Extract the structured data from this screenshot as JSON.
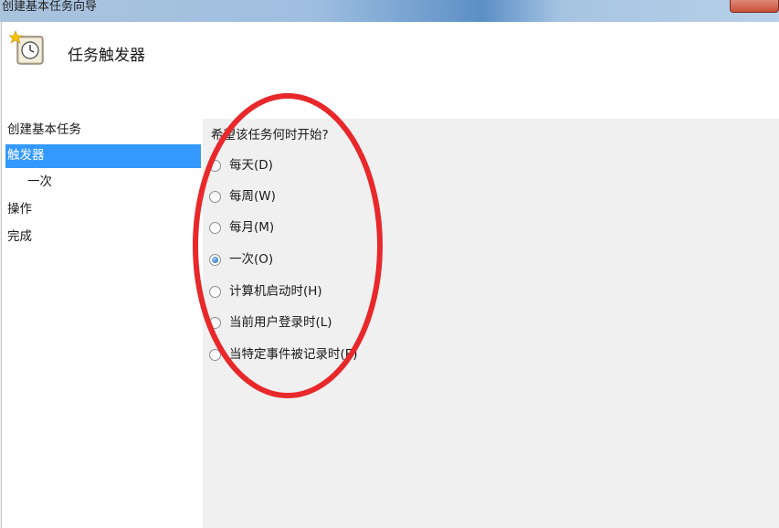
{
  "window": {
    "title": "创建基本任务向导",
    "colors": {
      "accent": "#3399ff",
      "annotation": "#e8282a"
    }
  },
  "header": {
    "title": "任务触发器",
    "icon": "clock-task-icon"
  },
  "sidebar": {
    "steps": [
      {
        "label": "创建基本任务",
        "selected": false
      },
      {
        "label": "触发器",
        "selected": true
      },
      {
        "label": "一次",
        "selected": false
      },
      {
        "label": "操作",
        "selected": false
      },
      {
        "label": "完成",
        "selected": false
      }
    ]
  },
  "main": {
    "question": "希望该任务何时开始?",
    "options": [
      {
        "label": "每天(D)",
        "checked": false
      },
      {
        "label": "每周(W)",
        "checked": false
      },
      {
        "label": "每月(M)",
        "checked": false
      },
      {
        "label": "一次(O)",
        "checked": true
      },
      {
        "label": "计算机启动时(H)",
        "checked": false
      },
      {
        "label": "当前用户登录时(L)",
        "checked": false
      },
      {
        "label": "当特定事件被记录时(E)",
        "checked": false
      }
    ]
  }
}
